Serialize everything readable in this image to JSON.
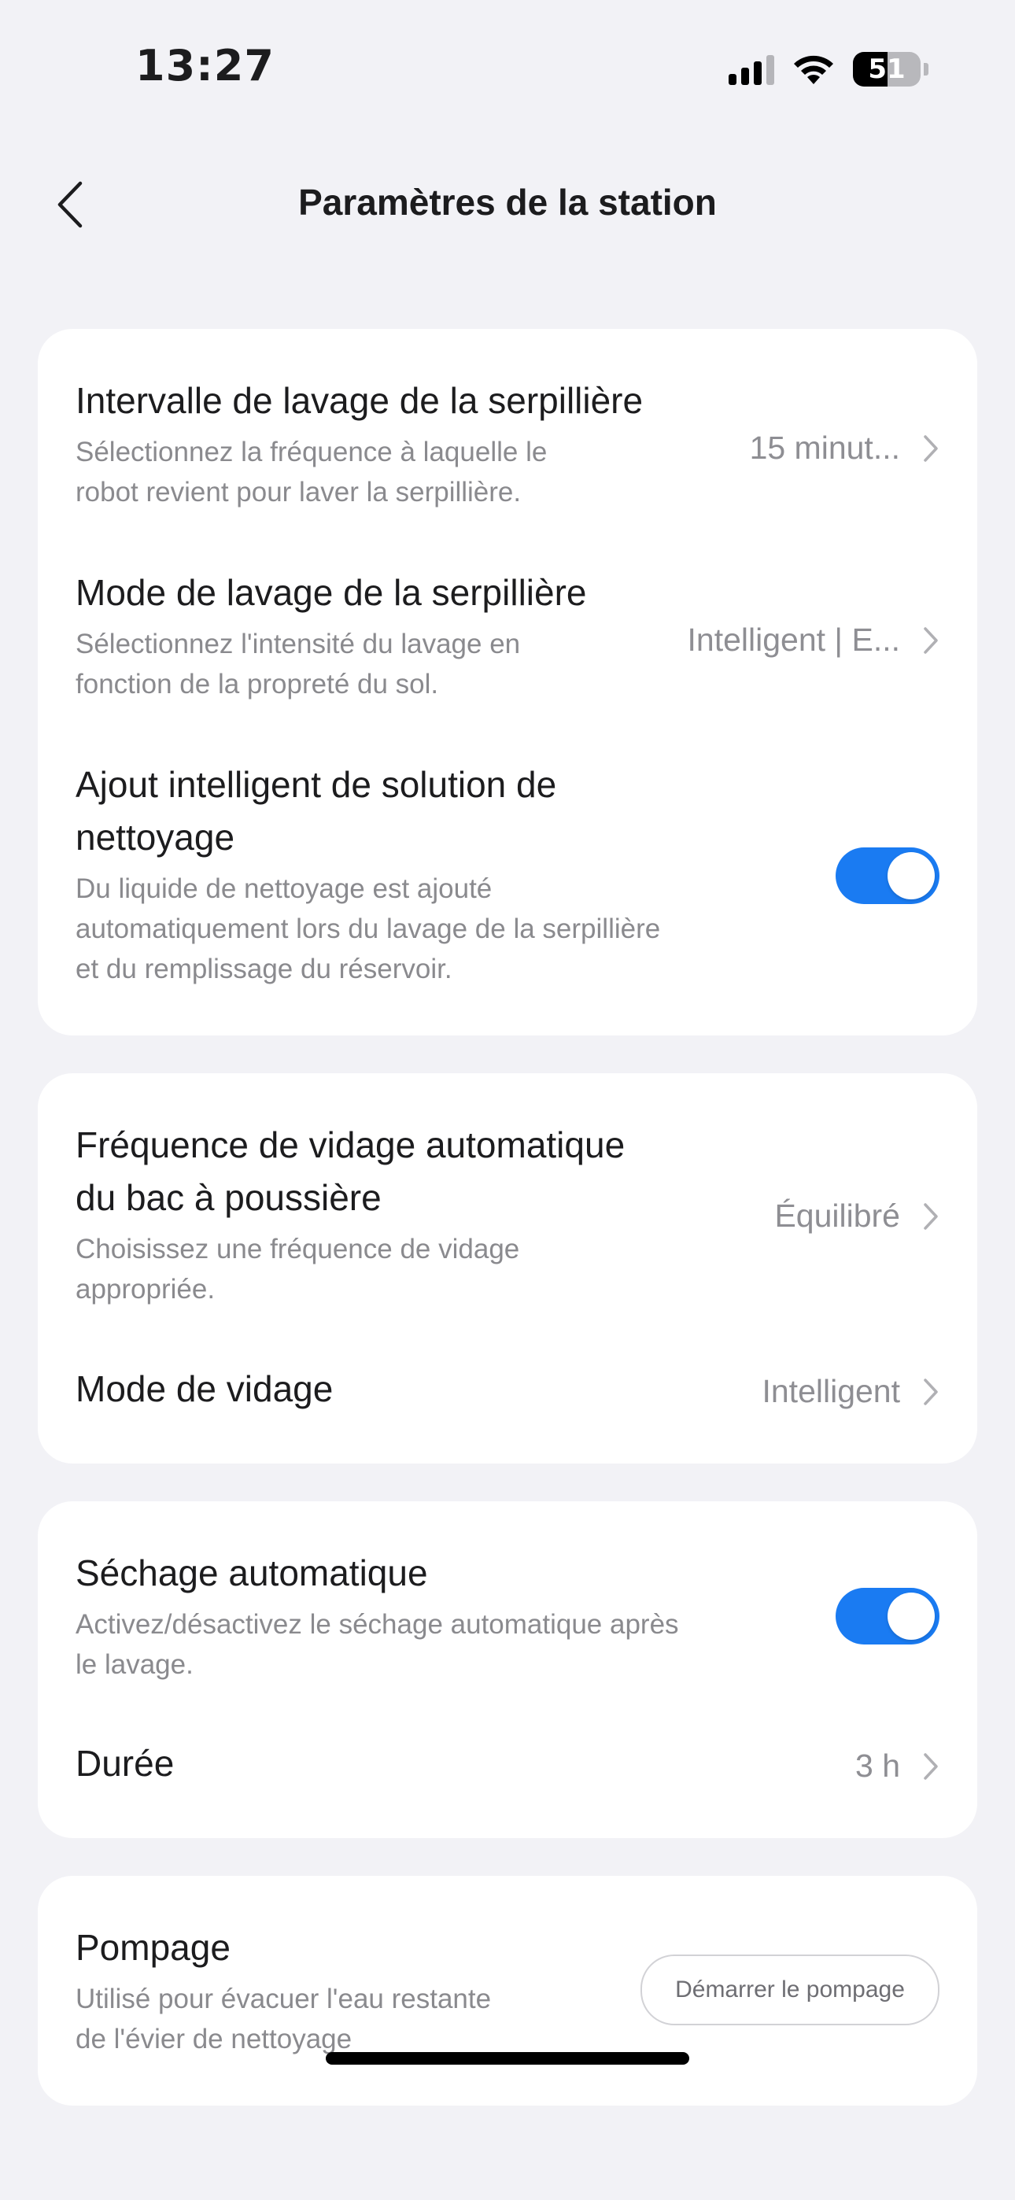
{
  "status_bar": {
    "time": "13:27",
    "battery_level": 51,
    "battery_label": "51"
  },
  "header": {
    "title": "Paramètres de la station"
  },
  "sections": {
    "mop": {
      "interval": {
        "title": "Intervalle de lavage de la serpillière",
        "desc_lines": [
          "Sélectionnez la fréquence à laquelle le",
          "robot revient pour laver la serpillière."
        ],
        "value": "15 minut..."
      },
      "wash_mode": {
        "title": "Mode de lavage de la serpillière",
        "desc_lines": [
          "Sélectionnez l'intensité du lavage en",
          "fonction de la propreté du sol."
        ],
        "value": "Intelligent | E..."
      },
      "smart_solution": {
        "title_lines": [
          "Ajout intelligent de solution de",
          "nettoyage"
        ],
        "desc_lines": [
          "Du liquide de nettoyage est ajouté",
          "automatiquement lors du lavage de la serpillière",
          "et du remplissage du réservoir."
        ],
        "enabled": true
      }
    },
    "dust": {
      "frequency": {
        "title_lines": [
          "Fréquence de vidage automatique",
          "du bac à poussière"
        ],
        "desc_lines": [
          "Choisissez une fréquence de vidage",
          "appropriée."
        ],
        "value": "Équilibré"
      },
      "empty_mode": {
        "title": "Mode de vidage",
        "value": "Intelligent"
      }
    },
    "drying": {
      "auto_dry": {
        "title": "Séchage automatique",
        "desc_lines": [
          "Activez/désactivez le séchage automatique après",
          "le lavage."
        ],
        "enabled": true
      },
      "duration": {
        "title": "Durée",
        "value": "3 h"
      }
    },
    "pump": {
      "title": "Pompage",
      "desc_lines": [
        "Utilisé pour évacuer l'eau restante",
        "de l'évier de nettoyage"
      ],
      "button_label": "Démarrer le pompage"
    }
  },
  "colors": {
    "accent": "#1a7bf2",
    "background": "#f2f2f6",
    "card": "#ffffff",
    "secondary_text": "#8a8a8e"
  }
}
